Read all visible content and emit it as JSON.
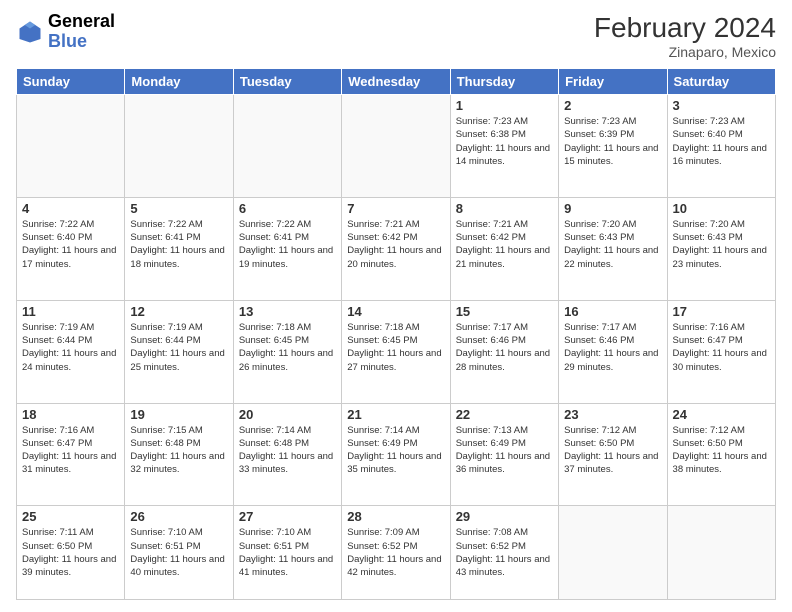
{
  "header": {
    "logo_general": "General",
    "logo_blue": "Blue",
    "month_year": "February 2024",
    "location": "Zinaparo, Mexico"
  },
  "days_of_week": [
    "Sunday",
    "Monday",
    "Tuesday",
    "Wednesday",
    "Thursday",
    "Friday",
    "Saturday"
  ],
  "weeks": [
    [
      {
        "day": "",
        "sunrise": "",
        "sunset": "",
        "daylight": ""
      },
      {
        "day": "",
        "sunrise": "",
        "sunset": "",
        "daylight": ""
      },
      {
        "day": "",
        "sunrise": "",
        "sunset": "",
        "daylight": ""
      },
      {
        "day": "",
        "sunrise": "",
        "sunset": "",
        "daylight": ""
      },
      {
        "day": "1",
        "sunrise": "7:23 AM",
        "sunset": "6:38 PM",
        "daylight": "11 hours and 14 minutes."
      },
      {
        "day": "2",
        "sunrise": "7:23 AM",
        "sunset": "6:39 PM",
        "daylight": "11 hours and 15 minutes."
      },
      {
        "day": "3",
        "sunrise": "7:23 AM",
        "sunset": "6:40 PM",
        "daylight": "11 hours and 16 minutes."
      }
    ],
    [
      {
        "day": "4",
        "sunrise": "7:22 AM",
        "sunset": "6:40 PM",
        "daylight": "11 hours and 17 minutes."
      },
      {
        "day": "5",
        "sunrise": "7:22 AM",
        "sunset": "6:41 PM",
        "daylight": "11 hours and 18 minutes."
      },
      {
        "day": "6",
        "sunrise": "7:22 AM",
        "sunset": "6:41 PM",
        "daylight": "11 hours and 19 minutes."
      },
      {
        "day": "7",
        "sunrise": "7:21 AM",
        "sunset": "6:42 PM",
        "daylight": "11 hours and 20 minutes."
      },
      {
        "day": "8",
        "sunrise": "7:21 AM",
        "sunset": "6:42 PM",
        "daylight": "11 hours and 21 minutes."
      },
      {
        "day": "9",
        "sunrise": "7:20 AM",
        "sunset": "6:43 PM",
        "daylight": "11 hours and 22 minutes."
      },
      {
        "day": "10",
        "sunrise": "7:20 AM",
        "sunset": "6:43 PM",
        "daylight": "11 hours and 23 minutes."
      }
    ],
    [
      {
        "day": "11",
        "sunrise": "7:19 AM",
        "sunset": "6:44 PM",
        "daylight": "11 hours and 24 minutes."
      },
      {
        "day": "12",
        "sunrise": "7:19 AM",
        "sunset": "6:44 PM",
        "daylight": "11 hours and 25 minutes."
      },
      {
        "day": "13",
        "sunrise": "7:18 AM",
        "sunset": "6:45 PM",
        "daylight": "11 hours and 26 minutes."
      },
      {
        "day": "14",
        "sunrise": "7:18 AM",
        "sunset": "6:45 PM",
        "daylight": "11 hours and 27 minutes."
      },
      {
        "day": "15",
        "sunrise": "7:17 AM",
        "sunset": "6:46 PM",
        "daylight": "11 hours and 28 minutes."
      },
      {
        "day": "16",
        "sunrise": "7:17 AM",
        "sunset": "6:46 PM",
        "daylight": "11 hours and 29 minutes."
      },
      {
        "day": "17",
        "sunrise": "7:16 AM",
        "sunset": "6:47 PM",
        "daylight": "11 hours and 30 minutes."
      }
    ],
    [
      {
        "day": "18",
        "sunrise": "7:16 AM",
        "sunset": "6:47 PM",
        "daylight": "11 hours and 31 minutes."
      },
      {
        "day": "19",
        "sunrise": "7:15 AM",
        "sunset": "6:48 PM",
        "daylight": "11 hours and 32 minutes."
      },
      {
        "day": "20",
        "sunrise": "7:14 AM",
        "sunset": "6:48 PM",
        "daylight": "11 hours and 33 minutes."
      },
      {
        "day": "21",
        "sunrise": "7:14 AM",
        "sunset": "6:49 PM",
        "daylight": "11 hours and 35 minutes."
      },
      {
        "day": "22",
        "sunrise": "7:13 AM",
        "sunset": "6:49 PM",
        "daylight": "11 hours and 36 minutes."
      },
      {
        "day": "23",
        "sunrise": "7:12 AM",
        "sunset": "6:50 PM",
        "daylight": "11 hours and 37 minutes."
      },
      {
        "day": "24",
        "sunrise": "7:12 AM",
        "sunset": "6:50 PM",
        "daylight": "11 hours and 38 minutes."
      }
    ],
    [
      {
        "day": "25",
        "sunrise": "7:11 AM",
        "sunset": "6:50 PM",
        "daylight": "11 hours and 39 minutes."
      },
      {
        "day": "26",
        "sunrise": "7:10 AM",
        "sunset": "6:51 PM",
        "daylight": "11 hours and 40 minutes."
      },
      {
        "day": "27",
        "sunrise": "7:10 AM",
        "sunset": "6:51 PM",
        "daylight": "11 hours and 41 minutes."
      },
      {
        "day": "28",
        "sunrise": "7:09 AM",
        "sunset": "6:52 PM",
        "daylight": "11 hours and 42 minutes."
      },
      {
        "day": "29",
        "sunrise": "7:08 AM",
        "sunset": "6:52 PM",
        "daylight": "11 hours and 43 minutes."
      },
      {
        "day": "",
        "sunrise": "",
        "sunset": "",
        "daylight": ""
      },
      {
        "day": "",
        "sunrise": "",
        "sunset": "",
        "daylight": ""
      }
    ]
  ]
}
